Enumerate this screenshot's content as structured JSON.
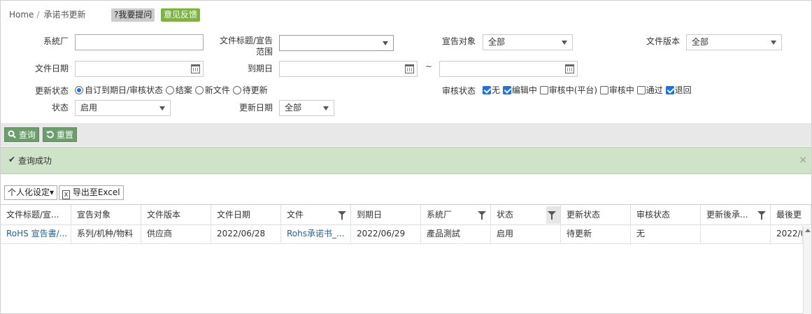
{
  "breadcrumb": {
    "home": "Home",
    "sep": "/",
    "current": "承诺书更新"
  },
  "tags": {
    "ask": "?我要提问",
    "feedback": "意见反馈"
  },
  "form": {
    "factory_label": "系統厂",
    "factory_value": "",
    "doc_title_label_1": "文件标题/宣告",
    "doc_title_label_2": "范围",
    "doc_title_value": "",
    "target_label": "宣告对象",
    "target_value": "全部",
    "version_label": "文件版本",
    "version_value": "全部",
    "doc_date_label": "文件日期",
    "expire_label": "到期日",
    "range_sep": "~",
    "update_status_label": "更新状态",
    "update_status_options": [
      "自订到期日/审核状态",
      "结案",
      "新文件",
      "待更新"
    ],
    "update_status_selected": 0,
    "review_status_label": "审核状态",
    "review_options": [
      {
        "label": "无",
        "checked": true
      },
      {
        "label": "编辑中",
        "checked": true
      },
      {
        "label": "审核中(平台)",
        "checked": false
      },
      {
        "label": "审核中",
        "checked": false
      },
      {
        "label": "通过",
        "checked": false
      },
      {
        "label": "退回",
        "checked": true
      }
    ],
    "status_label": "状态",
    "status_value": "启用",
    "update_date_label": "更新日期",
    "update_date_value": "全部"
  },
  "buttons": {
    "query": "查询",
    "reset": "重置"
  },
  "message": {
    "text": "查询成功",
    "close": "×"
  },
  "toolbar": {
    "personalize": "个人化设定▾",
    "export": "导出至Excel"
  },
  "table": {
    "headers": [
      "文件标题/宣...",
      "宣告对象",
      "文件版本",
      "文件日期",
      "文件",
      "到期日",
      "系統厂",
      "状态",
      "更新状态",
      "审核状态",
      "更新後承...",
      "最後更"
    ],
    "rows": [
      [
        "RoHS 宣告書/...",
        "系列/机种/物料",
        "供应商",
        "2022/06/28",
        "Rohs承诺书_...",
        "2022/06/29",
        "產品測試",
        "启用",
        "待更新",
        "无",
        "",
        "2022/0"
      ]
    ]
  },
  "colors": {
    "accent": "#6a9e6a",
    "feedback": "#7cb342",
    "success_bg": "#cfe3c9",
    "link": "#2a6496"
  }
}
